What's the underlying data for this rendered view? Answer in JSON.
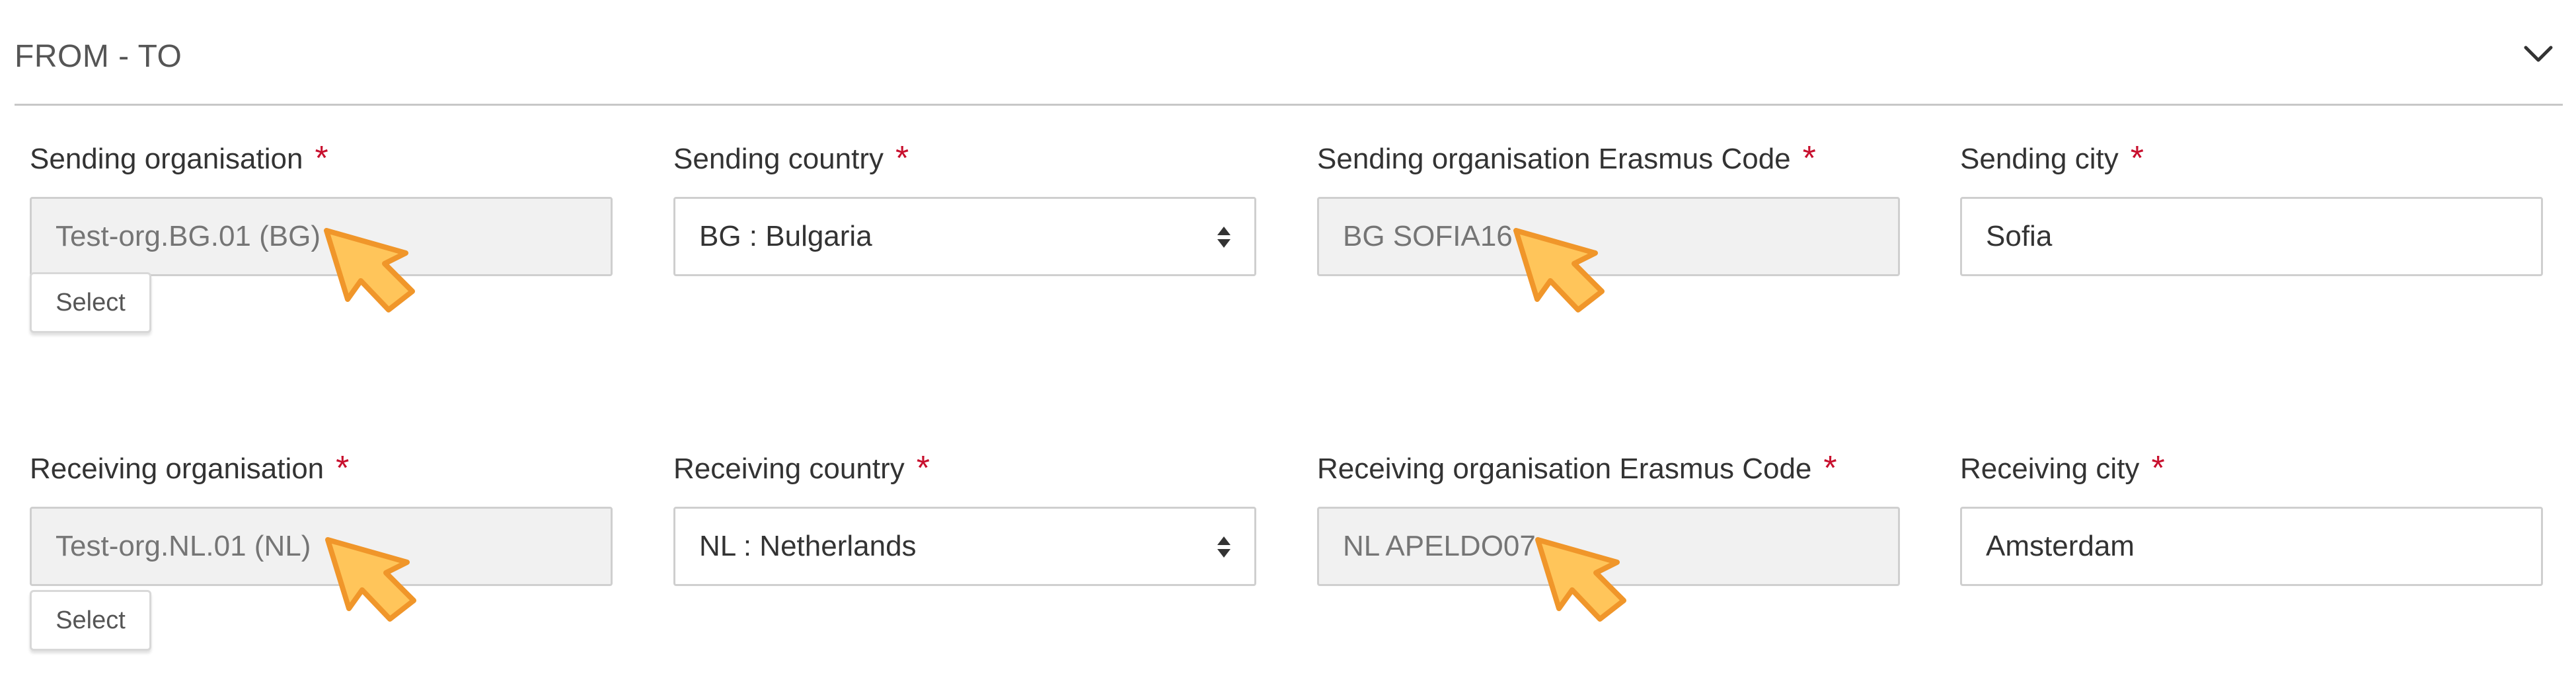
{
  "section": {
    "title": "FROM - TO",
    "collapse_icon": "chevron-down-icon"
  },
  "sending": {
    "organisation": {
      "label": "Sending organisation",
      "required_mark": "*",
      "value": "Test-org.BG.01 (BG)",
      "select_label": "Select"
    },
    "country": {
      "label": "Sending country",
      "required_mark": "*",
      "value": "BG : Bulgaria"
    },
    "erasmus_code": {
      "label": "Sending organisation Erasmus Code",
      "required_mark": "*",
      "value": "BG SOFIA16"
    },
    "city": {
      "label": "Sending city",
      "required_mark": "*",
      "value": "Sofia"
    }
  },
  "receiving": {
    "organisation": {
      "label": "Receiving organisation",
      "required_mark": "*",
      "value": "Test-org.NL.01 (NL)",
      "select_label": "Select"
    },
    "country": {
      "label": "Receiving country",
      "required_mark": "*",
      "value": "NL : Netherlands"
    },
    "erasmus_code": {
      "label": "Receiving organisation Erasmus Code",
      "required_mark": "*",
      "value": "NL APELDO07"
    },
    "city": {
      "label": "Receiving city",
      "required_mark": "*",
      "value": "Amsterdam"
    }
  },
  "colors": {
    "required": "#c8102e",
    "pointer_fill": "#ffc55a",
    "pointer_stroke": "#f0962a",
    "readonly_bg": "#f1f1f1"
  }
}
